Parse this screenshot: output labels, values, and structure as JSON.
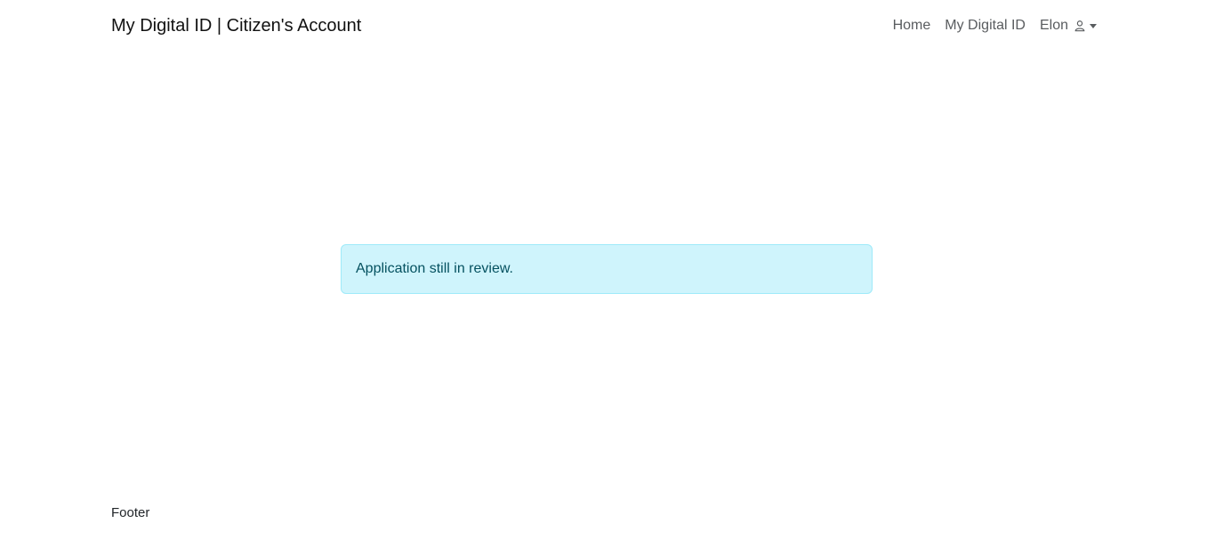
{
  "navbar": {
    "brand": "My Digital ID | Citizen's Account",
    "links": {
      "home": "Home",
      "digital_id": "My Digital ID",
      "user": "Elon"
    },
    "user_icon": "person-icon",
    "dropdown_icon": "caret-down-icon"
  },
  "alert": {
    "message": "Application still in review.",
    "colors": {
      "background": "#cff4fc",
      "border": "#9eeaf9",
      "text": "#055160"
    }
  },
  "footer": {
    "text": "Footer"
  }
}
